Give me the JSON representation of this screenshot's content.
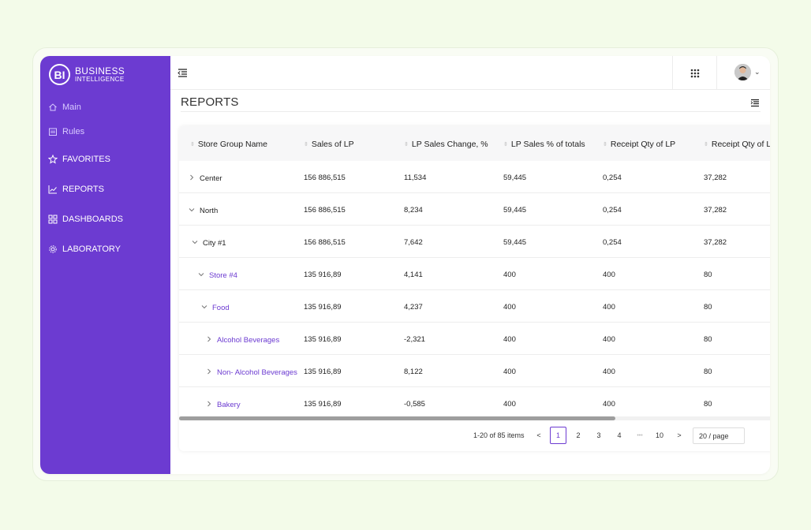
{
  "brand": {
    "badge": "BI",
    "line1": "BUSINESS",
    "line2": "INTELLIGENCE"
  },
  "sidebar": {
    "items": [
      {
        "label": "Main",
        "icon": "home-icon"
      },
      {
        "label": "Rules",
        "icon": "calendar-icon"
      },
      {
        "label": "FAVORITES",
        "icon": "star-icon"
      },
      {
        "label": "REPORTS",
        "icon": "line-chart-icon"
      },
      {
        "label": "DASHBOARDS",
        "icon": "grid-icon"
      },
      {
        "label": "LABORATORY",
        "icon": "gear-icon"
      }
    ]
  },
  "page": {
    "title": "REPORTS"
  },
  "table": {
    "columns": [
      "Store Group Name",
      "Sales of LP",
      "LP Sales Change, %",
      "LP Sales % of totals",
      "Receipt Qty of LP",
      "Receipt Qty of LP"
    ],
    "rows": [
      {
        "name": "Center",
        "chevron": "right",
        "values": [
          "156 886,515",
          "11,534",
          "59,445",
          "0,254",
          "37,282"
        ]
      },
      {
        "name": "North",
        "chevron": "down",
        "values": [
          "156 886,515",
          "8,234",
          "59,445",
          "0,254",
          "37,282"
        ]
      },
      {
        "name": "City #1",
        "chevron": "down",
        "values": [
          "156 886,515",
          "7,642",
          "59,445",
          "0,254",
          "37,282"
        ]
      },
      {
        "name": "Store #4",
        "chevron": "down",
        "values": [
          "135 916,89",
          "4,141",
          "400",
          "400",
          "80"
        ]
      },
      {
        "name": "Food",
        "chevron": "down",
        "values": [
          "135 916,89",
          "4,237",
          "400",
          "400",
          "80"
        ]
      },
      {
        "name": "Alcohol Beverages",
        "chevron": "right",
        "values": [
          "135 916,89",
          "-2,321",
          "400",
          "400",
          "80"
        ]
      },
      {
        "name": "Non- Alcohol Beverages",
        "chevron": "right",
        "values": [
          "135 916,89",
          "8,122",
          "400",
          "400",
          "80"
        ]
      },
      {
        "name": "Bakery",
        "chevron": "right",
        "values": [
          "135 916,89",
          "-0,585",
          "400",
          "400",
          "80"
        ]
      }
    ]
  },
  "pagination": {
    "summary": "1-20 of 85 items",
    "prev": "<",
    "pages": [
      "1",
      "2",
      "3",
      "4"
    ],
    "ellipsis": "•••",
    "last": "10",
    "next": ">",
    "page_size": "20 / page",
    "current": "1"
  },
  "colors": {
    "accent": "#6c3bd1",
    "background": "#f3fbe9"
  }
}
